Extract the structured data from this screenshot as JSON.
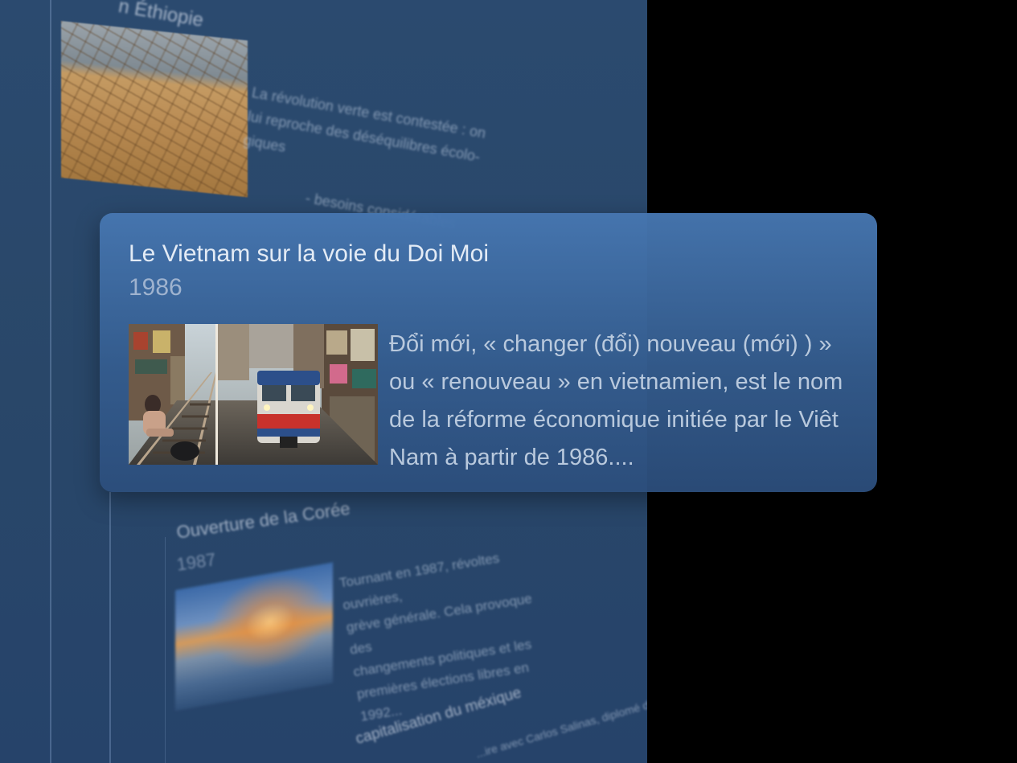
{
  "background": {
    "top_title": "n Éthiopie",
    "desert_text": [
      "La révolution verte est contestée : on",
      "lui reproche des déséquilibres écolo-",
      "giques"
    ],
    "desert_subtext": "- besoins considérables",
    "coree_title": "Ouverture de la Corée",
    "coree_year": "1987",
    "coree_text": [
      "Tournant en 1987, révoltes ouvrières,",
      "grève générale. Cela provoque des",
      "changements politiques et les",
      "premières élections libres en 1992..."
    ],
    "mexique_title": "capitalisation du méxique",
    "mexique_text": "...ire avec Carlos Salinas, diplomé de"
  },
  "card": {
    "title": "Le Vietnam sur la voie du Doi Moi",
    "year": "1986",
    "description": "Đổi mới, « changer (đổi) nouveau (mới) ) » ou « renouveau » en vietnamien, est le nom de la réforme économique initiée par le Viêt Nam à partir de 1986...."
  },
  "colors": {
    "card_background": "#4676b0",
    "page_background": "#2b4a6f",
    "title_text": "#e3ebf5",
    "body_text": "#b9c9dd"
  }
}
